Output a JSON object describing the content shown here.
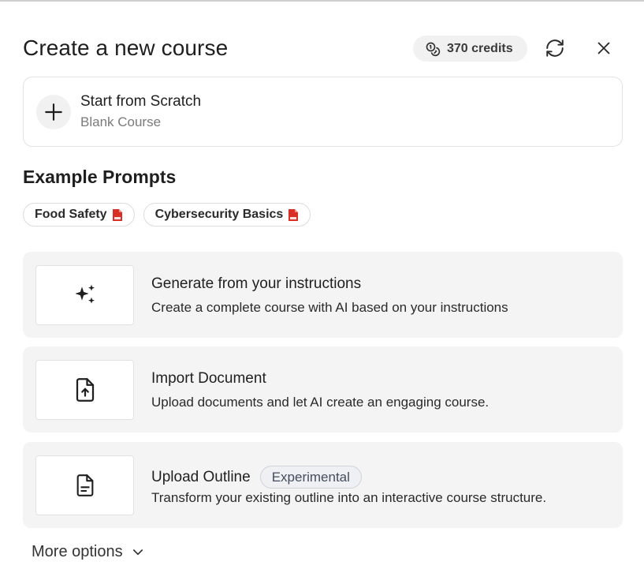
{
  "header": {
    "title": "Create a new course",
    "credits": "370 credits"
  },
  "scratch": {
    "title": "Start from Scratch",
    "subtitle": "Blank Course"
  },
  "examples": {
    "title": "Example Prompts",
    "chips": [
      "Food Safety",
      "Cybersecurity Basics"
    ]
  },
  "options": [
    {
      "title": "Generate from your instructions",
      "description": "Create a complete course with AI based on your instructions",
      "icon": "sparkles-icon"
    },
    {
      "title": "Import Document",
      "description": "Upload documents and let AI create an engaging course.",
      "icon": "file-upload-icon"
    },
    {
      "title": "Upload Outline",
      "badge": "Experimental",
      "description": "Transform your existing outline into an interactive course structure.",
      "icon": "file-text-icon"
    }
  ],
  "more_options": "More options",
  "colors": {
    "pdf_red": "#d93025",
    "card_bg": "#f4f4f4",
    "badge_bg": "#eef0f3"
  }
}
